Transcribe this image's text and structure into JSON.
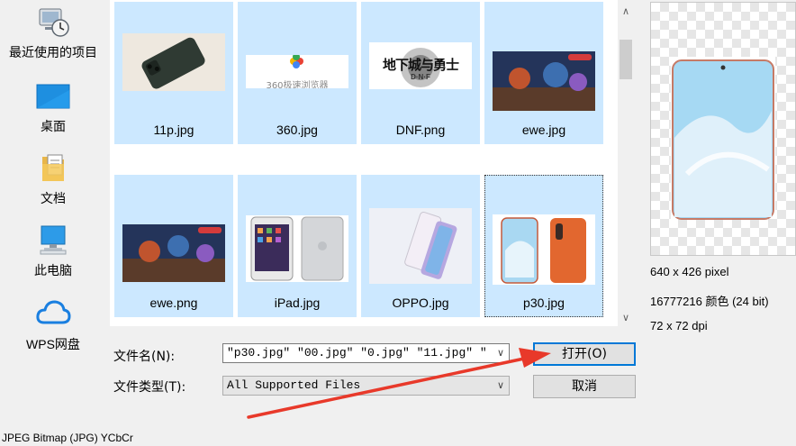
{
  "places": [
    {
      "label": "最近使用的项目",
      "icon": "recent-items-icon"
    },
    {
      "label": "桌面",
      "icon": "desktop-icon"
    },
    {
      "label": "文档",
      "icon": "documents-icon"
    },
    {
      "label": "此电脑",
      "icon": "this-pc-icon"
    },
    {
      "label": "WPS网盘",
      "icon": "wps-cloud-icon"
    }
  ],
  "files": [
    {
      "name": "11p.jpg"
    },
    {
      "name": "360.jpg",
      "thumb_text": "360极速浏览器"
    },
    {
      "name": "DNF.png",
      "thumb_text": "地下城与勇士",
      "thumb_subtext": "D·N·F"
    },
    {
      "name": "ewe.jpg"
    },
    {
      "name": "ewe.png"
    },
    {
      "name": "iPad.jpg"
    },
    {
      "name": "OPPO.jpg"
    },
    {
      "name": "p30.jpg"
    }
  ],
  "preview_info": {
    "dimensions": "640 x 426 pixel",
    "colors": "16777216 颜色 (24 bit)",
    "dpi": "72 x 72 dpi"
  },
  "form": {
    "filename_label": "文件名(N):",
    "filename_value": "\"p30.jpg\" \"00.jpg\" \"0.jpg\" \"11.jpg\" \"",
    "filetype_label": "文件类型(T):",
    "filetype_value": "All Supported Files",
    "open_label": "打开(O)",
    "cancel_label": "取消"
  },
  "status_text": "JPEG Bitmap (JPG) YCbCr",
  "colors": {
    "selection": "#cce8ff",
    "accent": "#0078d7",
    "arrow": "#e8392a"
  }
}
